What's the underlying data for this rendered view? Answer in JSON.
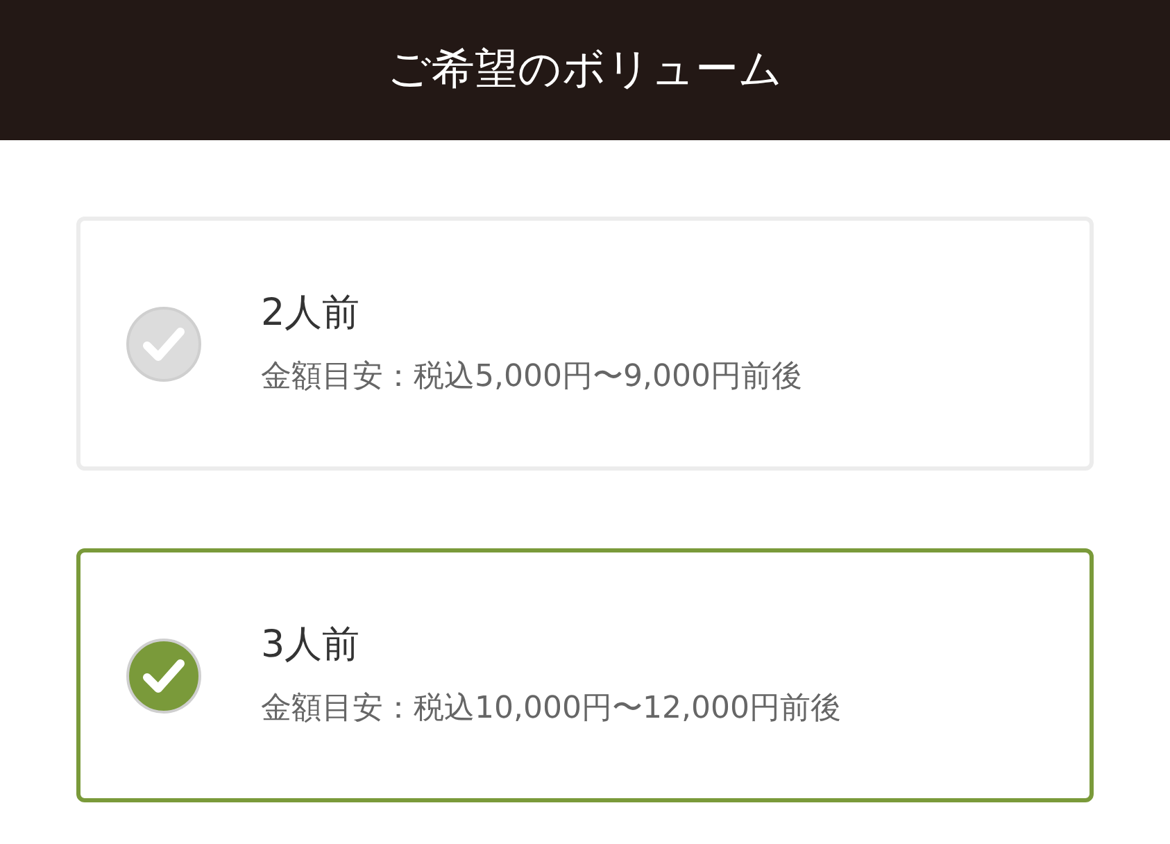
{
  "header": {
    "title": "ご希望のボリューム"
  },
  "options": [
    {
      "label": "2人前",
      "price": "金額目安：税込5,000円〜9,000円前後",
      "selected": false
    },
    {
      "label": "3人前",
      "price": "金額目安：税込10,000円〜12,000円前後",
      "selected": true
    }
  ]
}
